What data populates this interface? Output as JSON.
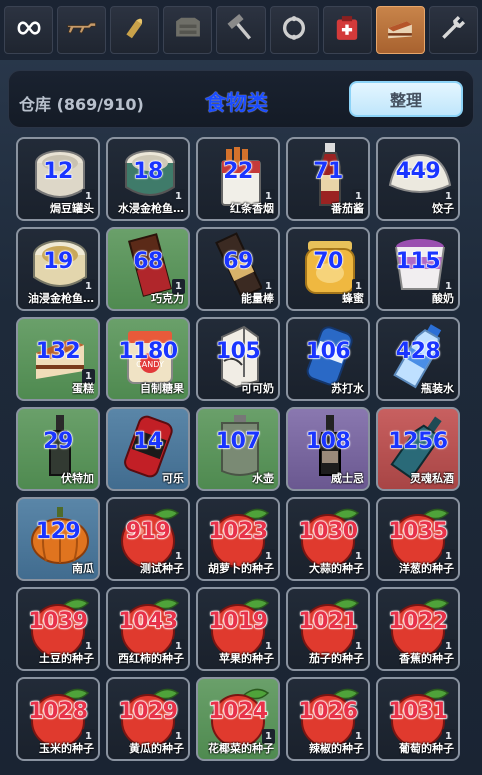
{
  "tabs": [
    {
      "icon": "infinity-icon",
      "active": false
    },
    {
      "icon": "rifle-icon",
      "active": false
    },
    {
      "icon": "ammo-icon",
      "active": false
    },
    {
      "icon": "armor-icon",
      "active": false
    },
    {
      "icon": "hammer-icon",
      "active": false
    },
    {
      "icon": "skull-ring-icon",
      "active": false
    },
    {
      "icon": "medkit-icon",
      "active": false
    },
    {
      "icon": "cake-icon",
      "active": true
    },
    {
      "icon": "wrench-icon",
      "active": false
    }
  ],
  "header": {
    "capacity": "仓库 (869/910)",
    "category": "食物类",
    "sort_label": "整理"
  },
  "items": [
    {
      "qty": "12",
      "name": "焗豆罐头",
      "badge": "1",
      "bg": "",
      "icon": "can",
      "red": false
    },
    {
      "qty": "18",
      "name": "水浸金枪鱼…",
      "badge": "1",
      "bg": "",
      "icon": "can-green",
      "red": false
    },
    {
      "qty": "22",
      "name": "红条香烟",
      "badge": "1",
      "bg": "",
      "icon": "cigarettes",
      "red": false
    },
    {
      "qty": "71",
      "name": "番茄酱",
      "badge": "1",
      "bg": "",
      "icon": "ketchup",
      "red": false
    },
    {
      "qty": "449",
      "name": "饺子",
      "badge": "1",
      "bg": "",
      "icon": "dumpling",
      "red": false
    },
    {
      "qty": "19",
      "name": "油浸金枪鱼…",
      "badge": "1",
      "bg": "",
      "icon": "can-open",
      "red": false
    },
    {
      "qty": "68",
      "name": "巧克力",
      "badge": "1",
      "bg": "green",
      "icon": "chocolate",
      "red": false
    },
    {
      "qty": "69",
      "name": "能量棒",
      "badge": "1",
      "bg": "",
      "icon": "energybar",
      "red": false
    },
    {
      "qty": "70",
      "name": "蜂蜜",
      "badge": "1",
      "bg": "",
      "icon": "honey",
      "red": false
    },
    {
      "qty": "115",
      "name": "酸奶",
      "badge": "1",
      "bg": "",
      "icon": "yogurt",
      "red": false
    },
    {
      "qty": "132",
      "name": "蛋糕",
      "badge": "1",
      "bg": "green",
      "icon": "cake",
      "red": false
    },
    {
      "qty": "1180",
      "name": "自制糖果",
      "badge": "",
      "bg": "green",
      "icon": "candy",
      "red": false
    },
    {
      "qty": "105",
      "name": "可可奶",
      "badge": "",
      "bg": "",
      "icon": "milkbox",
      "red": false
    },
    {
      "qty": "106",
      "name": "苏打水",
      "badge": "",
      "bg": "",
      "icon": "soda",
      "red": false
    },
    {
      "qty": "428",
      "name": "瓶装水",
      "badge": "",
      "bg": "",
      "icon": "waterbottle",
      "red": false
    },
    {
      "qty": "29",
      "name": "伏特加",
      "badge": "",
      "bg": "green",
      "icon": "vodka",
      "red": false
    },
    {
      "qty": "14",
      "name": "可乐",
      "badge": "",
      "bg": "blue",
      "icon": "cola",
      "red": false
    },
    {
      "qty": "107",
      "name": "水壶",
      "badge": "",
      "bg": "green",
      "icon": "flask",
      "red": false
    },
    {
      "qty": "108",
      "name": "威士忌",
      "badge": "",
      "bg": "purple",
      "icon": "whiskey",
      "red": false
    },
    {
      "qty": "1256",
      "name": "灵魂私酒",
      "badge": "",
      "bg": "red",
      "icon": "spirit",
      "red": false
    },
    {
      "qty": "129",
      "name": "南瓜",
      "badge": "",
      "bg": "blue",
      "icon": "pumpkin",
      "red": false
    },
    {
      "qty": "919",
      "name": "测试种子",
      "badge": "1",
      "bg": "",
      "icon": "seed",
      "red": true
    },
    {
      "qty": "1023",
      "name": "胡萝卜的种子",
      "badge": "1",
      "bg": "",
      "icon": "seed",
      "red": true
    },
    {
      "qty": "1030",
      "name": "大蒜的种子",
      "badge": "1",
      "bg": "",
      "icon": "seed",
      "red": true
    },
    {
      "qty": "1035",
      "name": "洋葱的种子",
      "badge": "1",
      "bg": "",
      "icon": "seed",
      "red": true
    },
    {
      "qty": "1039",
      "name": "土豆的种子",
      "badge": "1",
      "bg": "",
      "icon": "seed",
      "red": true
    },
    {
      "qty": "1043",
      "name": "西红柿的种子",
      "badge": "1",
      "bg": "",
      "icon": "seed",
      "red": true
    },
    {
      "qty": "1019",
      "name": "苹果的种子",
      "badge": "1",
      "bg": "",
      "icon": "seed",
      "red": true
    },
    {
      "qty": "1021",
      "name": "茄子的种子",
      "badge": "1",
      "bg": "",
      "icon": "seed",
      "red": true
    },
    {
      "qty": "1022",
      "name": "香蕉的种子",
      "badge": "1",
      "bg": "",
      "icon": "seed",
      "red": true
    },
    {
      "qty": "1028",
      "name": "玉米的种子",
      "badge": "1",
      "bg": "",
      "icon": "seed",
      "red": true
    },
    {
      "qty": "1029",
      "name": "黄瓜的种子",
      "badge": "1",
      "bg": "",
      "icon": "seed",
      "red": true
    },
    {
      "qty": "1024",
      "name": "花椰菜的种子",
      "badge": "1",
      "bg": "green",
      "icon": "seed",
      "red": true
    },
    {
      "qty": "1026",
      "name": "辣椒的种子",
      "badge": "1",
      "bg": "",
      "icon": "seed",
      "red": true
    },
    {
      "qty": "1031",
      "name": "葡萄的种子",
      "badge": "1",
      "bg": "",
      "icon": "seed",
      "red": true
    }
  ]
}
